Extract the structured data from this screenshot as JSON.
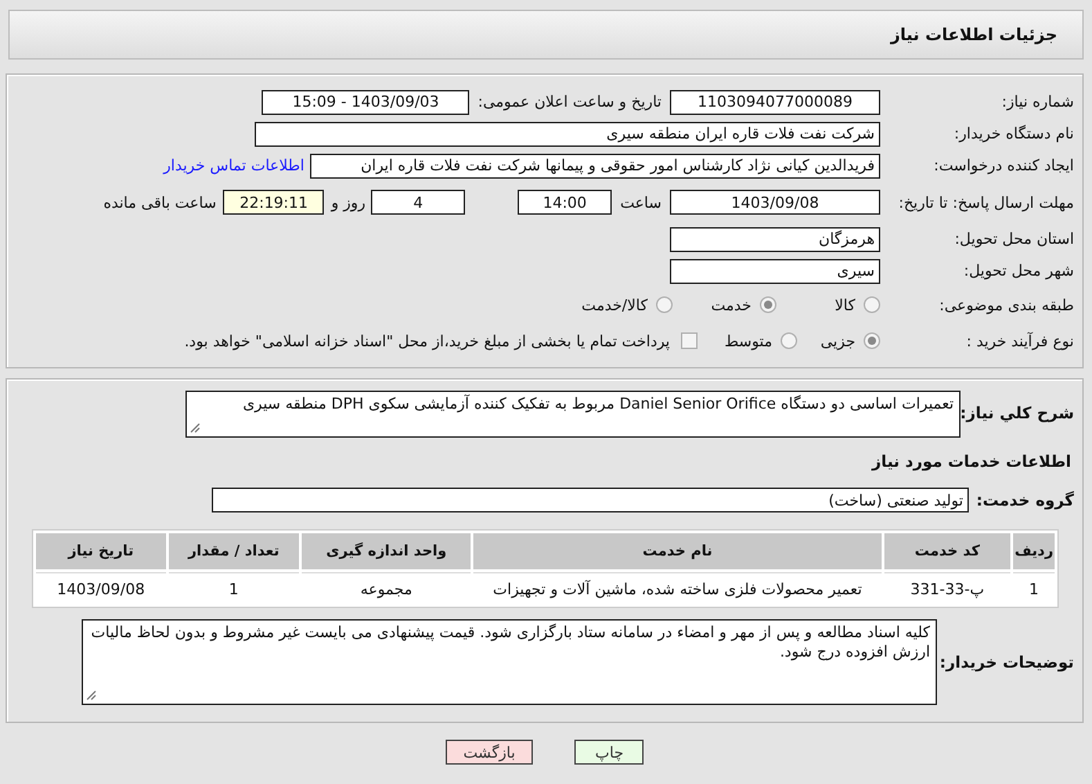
{
  "header": {
    "title": "جزئیات اطلاعات نیاز"
  },
  "details": {
    "need_number": {
      "label": "شماره نیاز:",
      "value": "1103094077000089"
    },
    "announce_date": {
      "label": "تاریخ و ساعت اعلان عمومی:",
      "value": "1403/09/03 - 15:09"
    },
    "buyer": {
      "label": "نام دستگاه خریدار:",
      "value": "شرکت نفت فلات قاره ایران منطقه سیری"
    },
    "creator": {
      "label": "ایجاد کننده درخواست:",
      "value": "فریدالدین کیانی نژاد کارشناس امور حقوقی و پیمانها شرکت نفت فلات قاره ایران",
      "link": "اطلاعات تماس خریدار"
    },
    "deadline": {
      "label": "مهلت ارسال پاسخ: تا تاریخ:",
      "date": "1403/09/08",
      "time_label": "ساعت",
      "time": "14:00",
      "days": "4",
      "days_label": "روز و",
      "remaining": "22:19:11",
      "remaining_label": "ساعت باقی مانده"
    },
    "province": {
      "label": "استان محل تحویل:",
      "value": "هرمزگان"
    },
    "city": {
      "label": "شهر محل تحویل:",
      "value": "سیری"
    },
    "category": {
      "label": "طبقه بندی موضوعی:",
      "options": [
        {
          "label": "کالا",
          "selected": false
        },
        {
          "label": "خدمت",
          "selected": true
        },
        {
          "label": "کالا/خدمت",
          "selected": false
        }
      ]
    },
    "process": {
      "label": "نوع فرآیند خرید :",
      "options": [
        {
          "label": "جزیی",
          "selected": true
        },
        {
          "label": "متوسط",
          "selected": false
        }
      ],
      "payment": {
        "checked": false,
        "text": "پرداخت تمام یا بخشی از مبلغ خرید،از محل \"اسناد خزانه اسلامی\" خواهد بود."
      }
    }
  },
  "summary": {
    "label": "شرح کلي نياز:",
    "value": "تعمیرات اساسی دو دستگاه Daniel Senior Orifice مربوط به تفکیک کننده آزمایشی سکوی DPH منطقه سیری"
  },
  "services_heading": "اطلاعات خدمات مورد نياز",
  "service_group": {
    "label": "گروه خدمت:",
    "value": "تولید صنعتی (ساخت)"
  },
  "table": {
    "columns": [
      "ردیف",
      "کد خدمت",
      "نام خدمت",
      "واحد اندازه گیری",
      "تعداد / مقدار",
      "تاریخ نیاز"
    ],
    "rows": [
      [
        "1",
        "پ-33-331",
        "تعمیر محصولات فلزی ساخته شده، ماشین آلات و تجهیزات",
        "مجموعه",
        "1",
        "1403/09/08"
      ]
    ]
  },
  "buyer_notes": {
    "label": "توضیحات خریدار:",
    "value": "کلیه اسناد مطالعه و پس از مهر و امضاء در سامانه ستاد بارگزاری شود. قیمت پیشنهادی می بایست غیر مشروط و بدون لحاظ مالیات ارزش افزوده درج شود."
  },
  "buttons": [
    {
      "label": "چاپ",
      "kind": "print"
    },
    {
      "label": "بازگشت",
      "kind": "back"
    }
  ]
}
